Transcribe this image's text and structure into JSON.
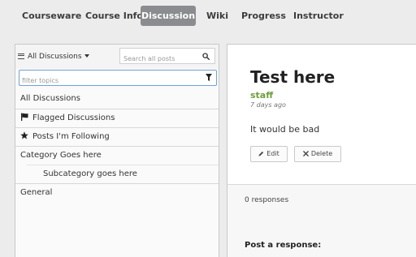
{
  "course_nav": {
    "tabs": [
      {
        "label": "Courseware",
        "active": false
      },
      {
        "label": "Course Info",
        "active": false
      },
      {
        "label": "Discussion",
        "active": true
      },
      {
        "label": "Wiki",
        "active": false
      },
      {
        "label": "Progress",
        "active": false
      },
      {
        "label": "Instructor",
        "active": false
      }
    ]
  },
  "sidebar": {
    "browse_label": "All Discussions",
    "search_placeholder": "Search all posts",
    "filter_placeholder": "filter topics",
    "topics": [
      {
        "label": "All Discussions",
        "icon": null
      },
      {
        "label": "Flagged Discussions",
        "icon": "flag-icon"
      },
      {
        "label": "Posts I'm Following",
        "icon": "star-icon"
      },
      {
        "label": "Category Goes here",
        "icon": null
      },
      {
        "label": "Subcategory goes here",
        "icon": null,
        "subcategory": true
      },
      {
        "label": "General",
        "icon": null
      }
    ]
  },
  "post": {
    "title": "Test here",
    "author": "staff",
    "time_ago": "7 days ago",
    "body": "It would be bad",
    "edit_label": "Edit",
    "delete_label": "Delete"
  },
  "responses": {
    "count_text": "0 responses",
    "post_response_label": "Post a response:"
  },
  "colors": {
    "active_tab_bg": "#8a8c8f",
    "author": "#6f9e3f",
    "filter_focus": "#6fa2d4"
  }
}
